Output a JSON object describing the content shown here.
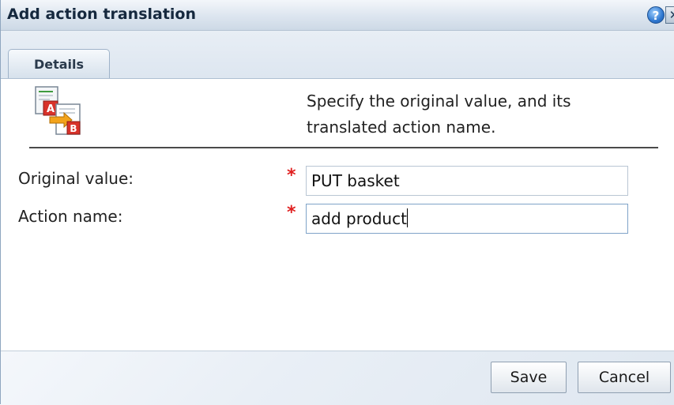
{
  "dialog": {
    "title": "Add action translation",
    "help_icon_glyph": "?",
    "close_icon_glyph": "✕"
  },
  "tabs": [
    {
      "label": "Details",
      "selected": true
    }
  ],
  "content": {
    "icon": "translate-a-to-b-icon",
    "description": "Specify the original value, and its translated action name."
  },
  "form": {
    "original_value": {
      "label": "Original value:",
      "required_marker": "*",
      "value": "PUT basket"
    },
    "action_name": {
      "label": "Action name:",
      "required_marker": "*",
      "value": "add product"
    }
  },
  "footer": {
    "save_label": "Save",
    "cancel_label": "Cancel"
  },
  "colors": {
    "required": "#e02020",
    "title_text": "#15283e",
    "help_icon": "#2f78d0"
  }
}
